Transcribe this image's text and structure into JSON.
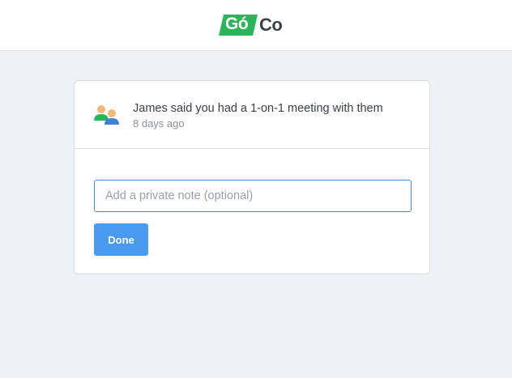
{
  "header": {
    "logo_go": "Gó",
    "logo_co": "Co",
    "brand_green": "#2bb55a"
  },
  "notification": {
    "icon": "people-icon",
    "message": "James said you had a 1-on-1 meeting with them",
    "time": "8 days ago"
  },
  "note": {
    "placeholder": "Add a private note (optional)",
    "value": ""
  },
  "actions": {
    "done_label": "Done",
    "accent": "#4b9af1"
  }
}
